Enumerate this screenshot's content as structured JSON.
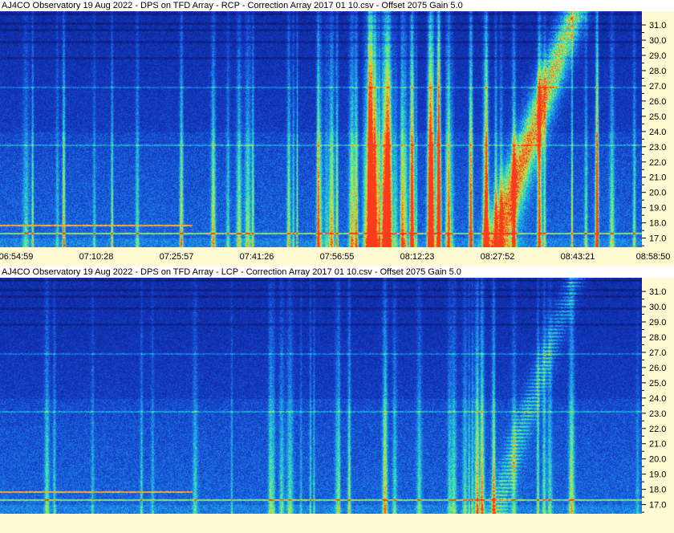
{
  "chart_data": [
    {
      "type": "heatmap",
      "title": "AJ4CO Observatory 19 Aug 2022  -  DPS on TFD Array  -  RCP  -  Correction Array 2017 01 10.csv  -  Offset 2075  Gain 5.0",
      "polarization": "RCP",
      "y_ticks": [
        "31.0",
        "30.0",
        "29.0",
        "28.0",
        "27.0",
        "26.0",
        "25.0",
        "24.0",
        "23.0",
        "22.0",
        "21.0",
        "20.0",
        "19.0",
        "18.0",
        "17.0"
      ],
      "ylim": [
        16.4,
        31.9
      ],
      "x_ticks": [
        "06:54:59",
        "07:10:28",
        "07:25:57",
        "07:41:26",
        "07:56:55",
        "08:12:23",
        "08:27:52",
        "08:43:21",
        "08:58:50"
      ]
    },
    {
      "type": "heatmap",
      "title": "AJ4CO Observatory 19 Aug 2022  -  DPS on TFD Array  -  LCP  -  Correction Array 2017 01 10.csv  -  Offset 2075  Gain 5.0",
      "polarization": "LCP",
      "y_ticks": [
        "31.0",
        "30.0",
        "29.0",
        "28.0",
        "27.0",
        "26.0",
        "25.0",
        "24.0",
        "23.0",
        "22.0",
        "21.0",
        "20.0",
        "19.0",
        "18.0",
        "17.0"
      ],
      "ylim": [
        16.4,
        31.9
      ]
    }
  ],
  "colors": {
    "background": "#1438b4",
    "axis_bg": "#fffbd2",
    "burst_hot": "#ff4020",
    "burst_mid": "#20e0a0"
  }
}
